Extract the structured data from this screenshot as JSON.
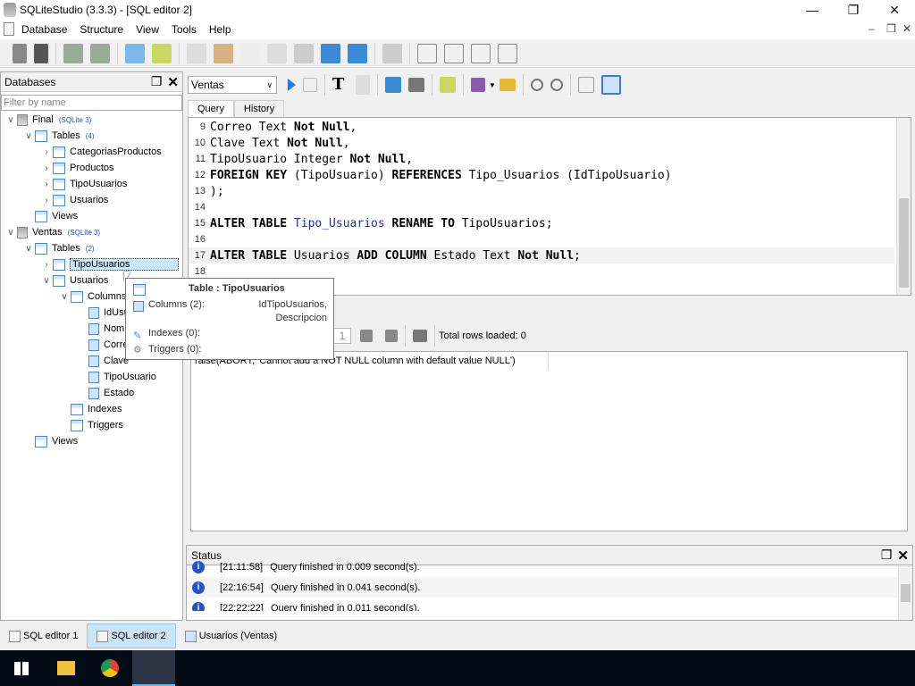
{
  "window": {
    "title": "SQLiteStudio (3.3.3) - [SQL editor 2]"
  },
  "menu": [
    "Database",
    "Structure",
    "View",
    "Tools",
    "Help"
  ],
  "databases_panel": {
    "title": "Databases",
    "filter_placeholder": "Filter by name",
    "tree": [
      {
        "label": "Final",
        "badge": "(SQLite 3)",
        "level": 0,
        "arrow": "v"
      },
      {
        "label": "Tables",
        "badge": "(4)",
        "level": 1,
        "arrow": "v"
      },
      {
        "label": "CategoriasProductos",
        "level": 2,
        "arrow": ">"
      },
      {
        "label": "Productos",
        "level": 2,
        "arrow": ">"
      },
      {
        "label": "TipoUsuarios",
        "level": 2,
        "arrow": ">"
      },
      {
        "label": "Usuarios",
        "level": 2,
        "arrow": ">"
      },
      {
        "label": "Views",
        "level": 1,
        "arrow": ""
      },
      {
        "label": "Ventas",
        "badge": "(SQLite 3)",
        "level": 0,
        "arrow": "v"
      },
      {
        "label": "Tables",
        "badge": "(2)",
        "level": 1,
        "arrow": "v"
      },
      {
        "label": "TipoUsuarios",
        "level": 2,
        "arrow": ">",
        "selected": true
      },
      {
        "label": "Usuarios",
        "level": 2,
        "arrow": "v"
      },
      {
        "label": "Columns",
        "level": 3,
        "arrow": "v"
      },
      {
        "label": "IdUsuario",
        "level": 4,
        "arrow": ""
      },
      {
        "label": "Nombre",
        "level": 4,
        "arrow": ""
      },
      {
        "label": "Correo",
        "level": 4,
        "arrow": ""
      },
      {
        "label": "Clave",
        "level": 4,
        "arrow": ""
      },
      {
        "label": "TipoUsuario",
        "level": 4,
        "arrow": ""
      },
      {
        "label": "Estado",
        "level": 4,
        "arrow": ""
      },
      {
        "label": "Indexes",
        "level": 3,
        "arrow": ""
      },
      {
        "label": "Triggers",
        "level": 3,
        "arrow": ""
      },
      {
        "label": "Views",
        "level": 1,
        "arrow": ""
      }
    ]
  },
  "tooltip": {
    "title": "Table : TipoUsuarios",
    "columns_label": "Columns (2):",
    "columns_value1": "IdTipoUsuarios,",
    "columns_value2": "Descripcion",
    "indexes_label": "Indexes (0):",
    "triggers_label": "Triggers (0):"
  },
  "editor": {
    "database": "Ventas",
    "tabs": [
      "Query",
      "History"
    ],
    "lines": [
      {
        "n": "9",
        "html": "Correo Text <b>Not Null</b>,"
      },
      {
        "n": "10",
        "html": "Clave Text <b>Not Null</b>,"
      },
      {
        "n": "11",
        "html": "TipoUsuario Integer <b>Not Null</b>,"
      },
      {
        "n": "12",
        "html": "<b>FOREIGN KEY</b> (TipoUsuario) <b>REFERENCES</b> Tipo_Usuarios (IdTipoUsuario)"
      },
      {
        "n": "13",
        "html": ");"
      },
      {
        "n": "14",
        "html": ""
      },
      {
        "n": "15",
        "html": "<b>ALTER TABLE</b> <span class='id'>Tipo_Usuarios</span> <b>RENAME TO</b> TipoUsuarios;"
      },
      {
        "n": "16",
        "html": ""
      },
      {
        "n": "17",
        "html": "<b>ALTER TABLE</b> Usuarios <b>ADD COLUMN</b> Estado Text <b>Not Null</b>;",
        "current": true
      },
      {
        "n": "18",
        "html": ""
      }
    ]
  },
  "results": {
    "page": "1",
    "total_rows": "Total rows loaded: 0",
    "error": "raise(ABORT, 'Cannot add a NOT NULL column with default value NULL')"
  },
  "status": {
    "title": "Status",
    "messages": [
      {
        "time": "[21:11:58]",
        "text": "Query finished in 0.009 second(s)."
      },
      {
        "time": "[22:16:54]",
        "text": "Query finished in 0.041 second(s)."
      },
      {
        "time": "[22:22:22]",
        "text": "Query finished in 0.011 second(s)."
      }
    ]
  },
  "bottom_tabs": [
    {
      "label": "SQL editor 1"
    },
    {
      "label": "SQL editor 2",
      "active": true
    },
    {
      "label": "Usuarios (Ventas)"
    }
  ],
  "taskbar": [
    "windows-start",
    "file-explorer",
    "chrome",
    "sqlitestudio"
  ]
}
